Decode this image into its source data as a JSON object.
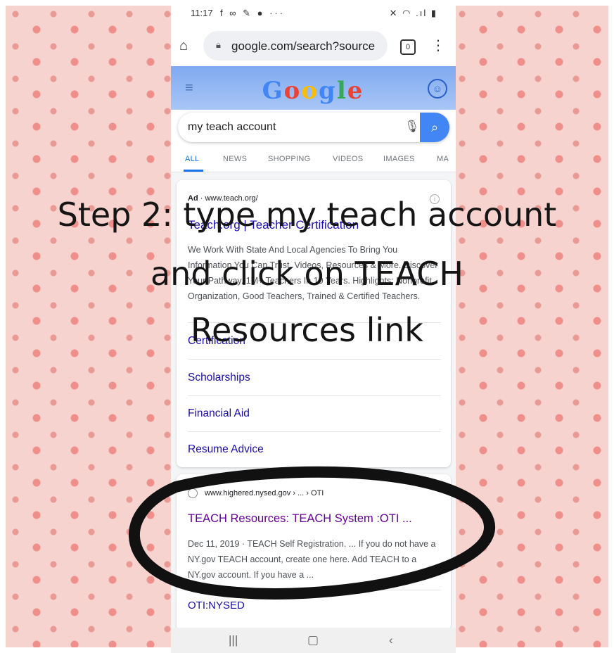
{
  "status_bar": {
    "time": "11:17",
    "icons_left": "f ∞ ✎ ● ···",
    "icons_right": "✕ ◠ .ıl ▮"
  },
  "browser": {
    "url": "google.com/search?source",
    "tabs_count": "0"
  },
  "google": {
    "doodle_letters": [
      "G",
      "o",
      "o",
      "g",
      "l",
      "e"
    ],
    "search_query": "my teach account",
    "tabs": [
      "ALL",
      "NEWS",
      "SHOPPING",
      "VIDEOS",
      "IMAGES",
      "MA"
    ],
    "active_tab": "ALL"
  },
  "ad_result": {
    "label": "Ad",
    "url": "· www.teach.org/",
    "title": "Teach.org | Teacher Certification",
    "description": "We Work With State And Local Agencies To Bring You Information You Can Trust. Videos, Resources & More. Discover Your Pathway. 1M+ Teachers In 10 Years. Highlights: Nonprofit Organization, Good Teachers, Trained & Certified Teachers.",
    "sitelinks": [
      "Certification",
      "Scholarships",
      "Financial Aid",
      "Resume Advice"
    ]
  },
  "organic_result": {
    "url": "www.highered.nysed.gov › ... › OTI",
    "title": "TEACH Resources: TEACH System :OTI ...",
    "description": "Dec 11, 2019 · TEACH Self Registration. ... If you do not have a NY.gov TEACH account, create one here. Add TEACH to a NY.gov account. If you have a ...",
    "sitelink": "OTI:NYSED"
  },
  "overlay": {
    "line1": "Step 2: type my teach account",
    "line2": "and click on TEACH",
    "line3": "Resources link"
  },
  "colors": {
    "background_pattern": "#f6d3cf",
    "google_blue": "#4285f4",
    "link_blue": "#1a0dab",
    "visited_purple": "#660099",
    "annotation_ink": "#111111"
  }
}
